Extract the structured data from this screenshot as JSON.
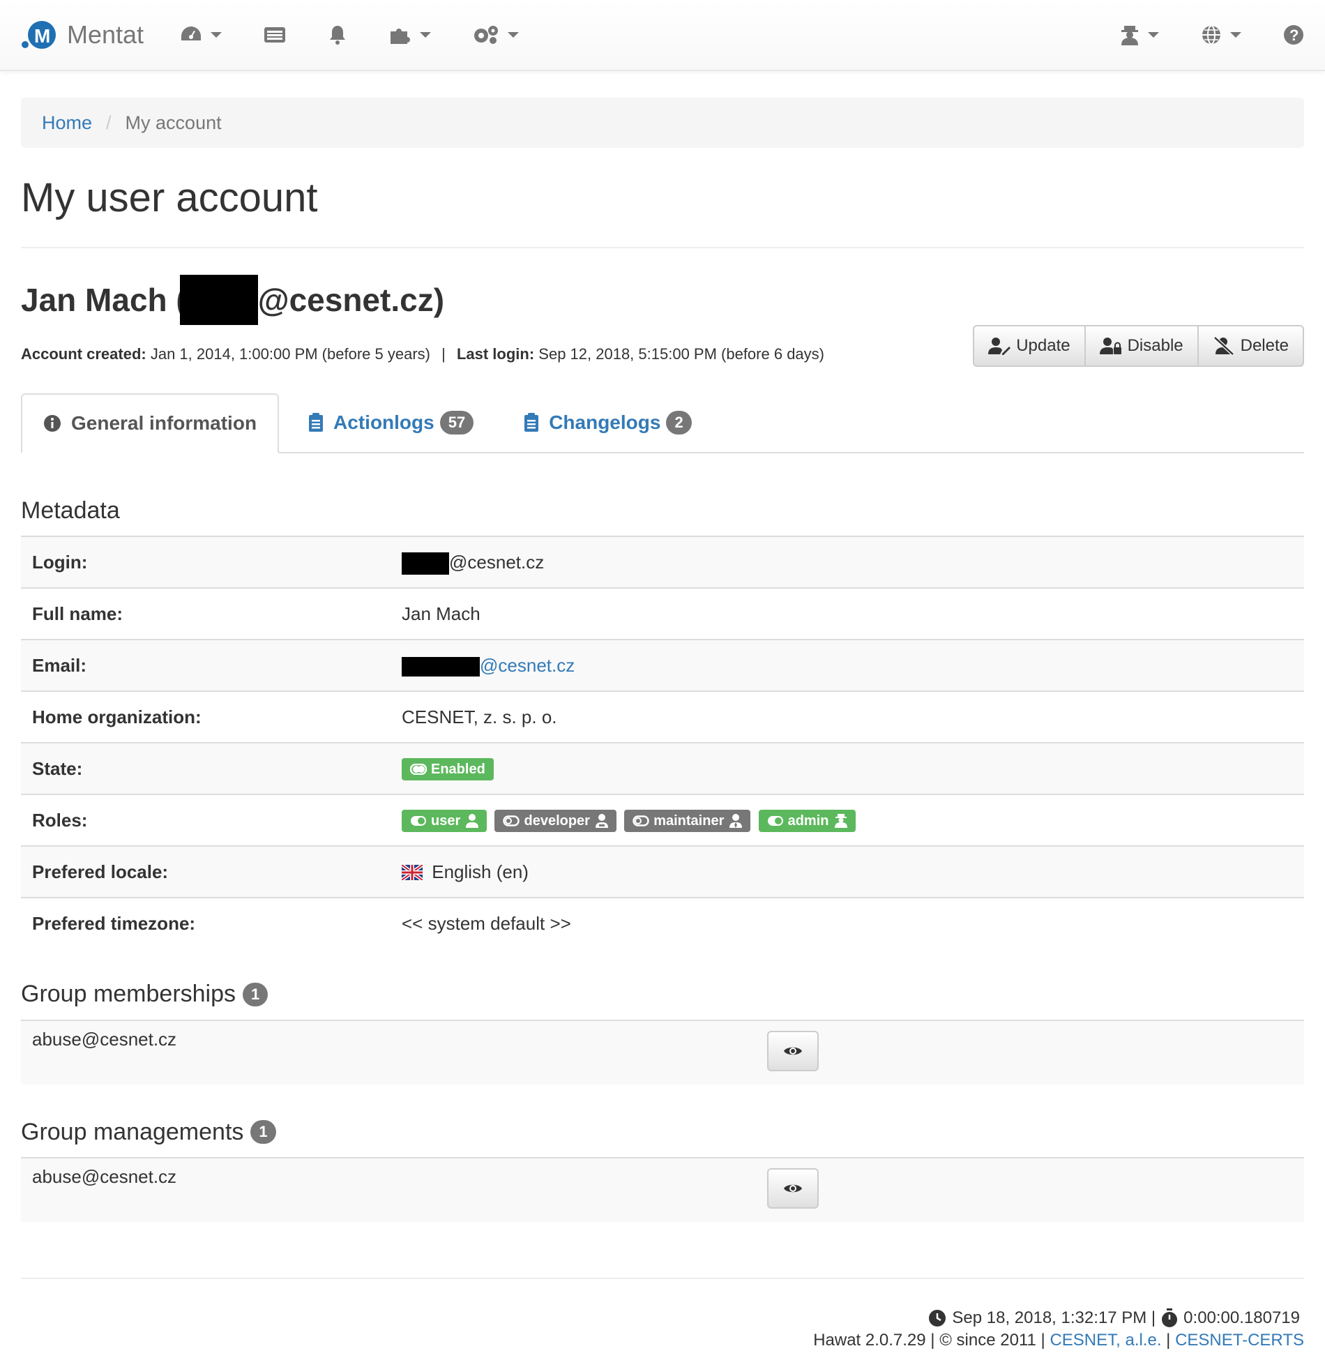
{
  "navbar": {
    "brand": "Mentat",
    "icons": [
      "dashboard-icon",
      "list-icon",
      "bell-icon",
      "puzzle-icon",
      "gears-icon",
      "user-secret-icon",
      "globe-icon",
      "help-icon"
    ]
  },
  "breadcrumb": {
    "home": "Home",
    "current": "My account"
  },
  "page_title": "My user account",
  "user": {
    "name_prefix": "Jan Mach (",
    "name_suffix": "@cesnet.cz)",
    "created_label": "Account created:",
    "created_value": "Jan 1, 2014, 1:00:00 PM (before 5 years)",
    "separator": "|",
    "last_login_label": "Last login:",
    "last_login_value": "Sep 12, 2018, 5:15:00 PM (before 6 days)"
  },
  "actions": {
    "update": "Update",
    "disable": "Disable",
    "delete": "Delete"
  },
  "tabs": [
    {
      "label": "General information",
      "badge": ""
    },
    {
      "label": "Actionlogs",
      "badge": "57"
    },
    {
      "label": "Changelogs",
      "badge": "2"
    }
  ],
  "metadata": {
    "title": "Metadata",
    "rows": {
      "login": {
        "label": "Login:",
        "value": "@cesnet.cz"
      },
      "fullname": {
        "label": "Full name:",
        "value": "Jan Mach"
      },
      "email": {
        "label": "Email:",
        "value": "@cesnet.cz"
      },
      "org": {
        "label": "Home organization:",
        "value": "CESNET, z. s. p. o."
      },
      "state": {
        "label": "State:",
        "value": "Enabled"
      },
      "roles": {
        "label": "Roles:",
        "values": [
          "user",
          "developer",
          "maintainer",
          "admin"
        ]
      },
      "locale": {
        "label": "Prefered locale:",
        "value": "English (en)"
      },
      "timezone": {
        "label": "Prefered timezone:",
        "value": "<< system default >>"
      }
    }
  },
  "memberships": {
    "title": "Group memberships",
    "count": "1",
    "items": [
      "abuse@cesnet.cz"
    ]
  },
  "managements": {
    "title": "Group managements",
    "count": "1",
    "items": [
      "abuse@cesnet.cz"
    ]
  },
  "footer": {
    "timestamp": "Sep 18, 2018, 1:32:17 PM |",
    "duration": "0:00:00.180719",
    "version": "Hawat 2.0.7.29 | © since 2011 |",
    "link1": "CESNET, a.l.e.",
    "pipe": "|",
    "link2": "CESNET-CERTS"
  },
  "colors": {
    "link": "#337ab7",
    "success": "#5cb85c",
    "default_label": "#777777"
  }
}
